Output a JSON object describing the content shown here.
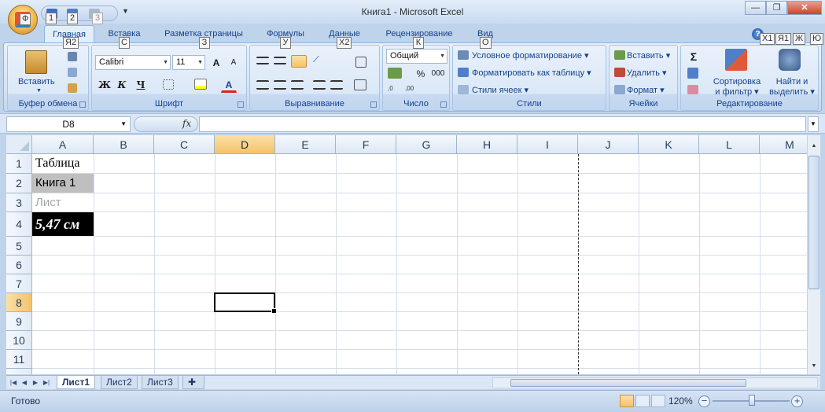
{
  "window": {
    "title": "Книга1 - Microsoft Excel",
    "office_button_keytip": "Ф",
    "qat_keytips": [
      "1",
      "2",
      "3"
    ],
    "minimize": "—",
    "restore": "❐",
    "close": "✕"
  },
  "tabs": [
    {
      "label": "Главная",
      "keytip": "Я2"
    },
    {
      "label": "Вставка",
      "keytip": "С"
    },
    {
      "label": "Разметка страницы",
      "keytip": "З"
    },
    {
      "label": "Формулы",
      "keytip": "У"
    },
    {
      "label": "Данные",
      "keytip": "Х2"
    },
    {
      "label": "Рецензирование",
      "keytip": "К"
    },
    {
      "label": "Вид",
      "keytip": "О"
    }
  ],
  "right_keytips": [
    "Х1",
    "Я1",
    "Ж",
    "Ю"
  ],
  "ribbon": {
    "clipboard": {
      "label": "Буфер обмена",
      "paste": "Вставить"
    },
    "font": {
      "label": "Шрифт",
      "font_name": "Calibri",
      "font_size": "11",
      "bold": "Ж",
      "italic": "К",
      "underline": "Ч"
    },
    "alignment": {
      "label": "Выравнивание"
    },
    "number": {
      "label": "Число",
      "format": "Общий",
      "percent": "%",
      "thousands": "000"
    },
    "styles": {
      "label": "Стили",
      "conditional": "Условное форматирование",
      "as_table": "Форматировать как таблицу",
      "cell_styles": "Стили ячеек"
    },
    "cells": {
      "label": "Ячейки",
      "insert": "Вставить",
      "delete": "Удалить",
      "format": "Формат"
    },
    "editing": {
      "label": "Редактирование",
      "sort_line1": "Сортировка",
      "sort_line2": "и фильтр",
      "find_line1": "Найти и",
      "find_line2": "выделить",
      "sum": "Σ"
    }
  },
  "formula_bar": {
    "name_box": "D8",
    "fx": "fx",
    "value": ""
  },
  "grid": {
    "columns": [
      "A",
      "B",
      "C",
      "D",
      "E",
      "F",
      "G",
      "H",
      "I",
      "J",
      "K",
      "L",
      "M"
    ],
    "rows": [
      "1",
      "2",
      "3",
      "4",
      "5",
      "6",
      "7",
      "8",
      "9",
      "10",
      "11"
    ],
    "selected_column": "D",
    "selected_row": "8",
    "cells": {
      "A1": "Таблица",
      "A2": "Книга 1",
      "A3": "Лист",
      "A4": "5,47 см"
    }
  },
  "sheets": [
    "Лист1",
    "Лист2",
    "Лист3"
  ],
  "active_sheet": "Лист1",
  "status": {
    "text": "Готово",
    "zoom": "120%"
  }
}
